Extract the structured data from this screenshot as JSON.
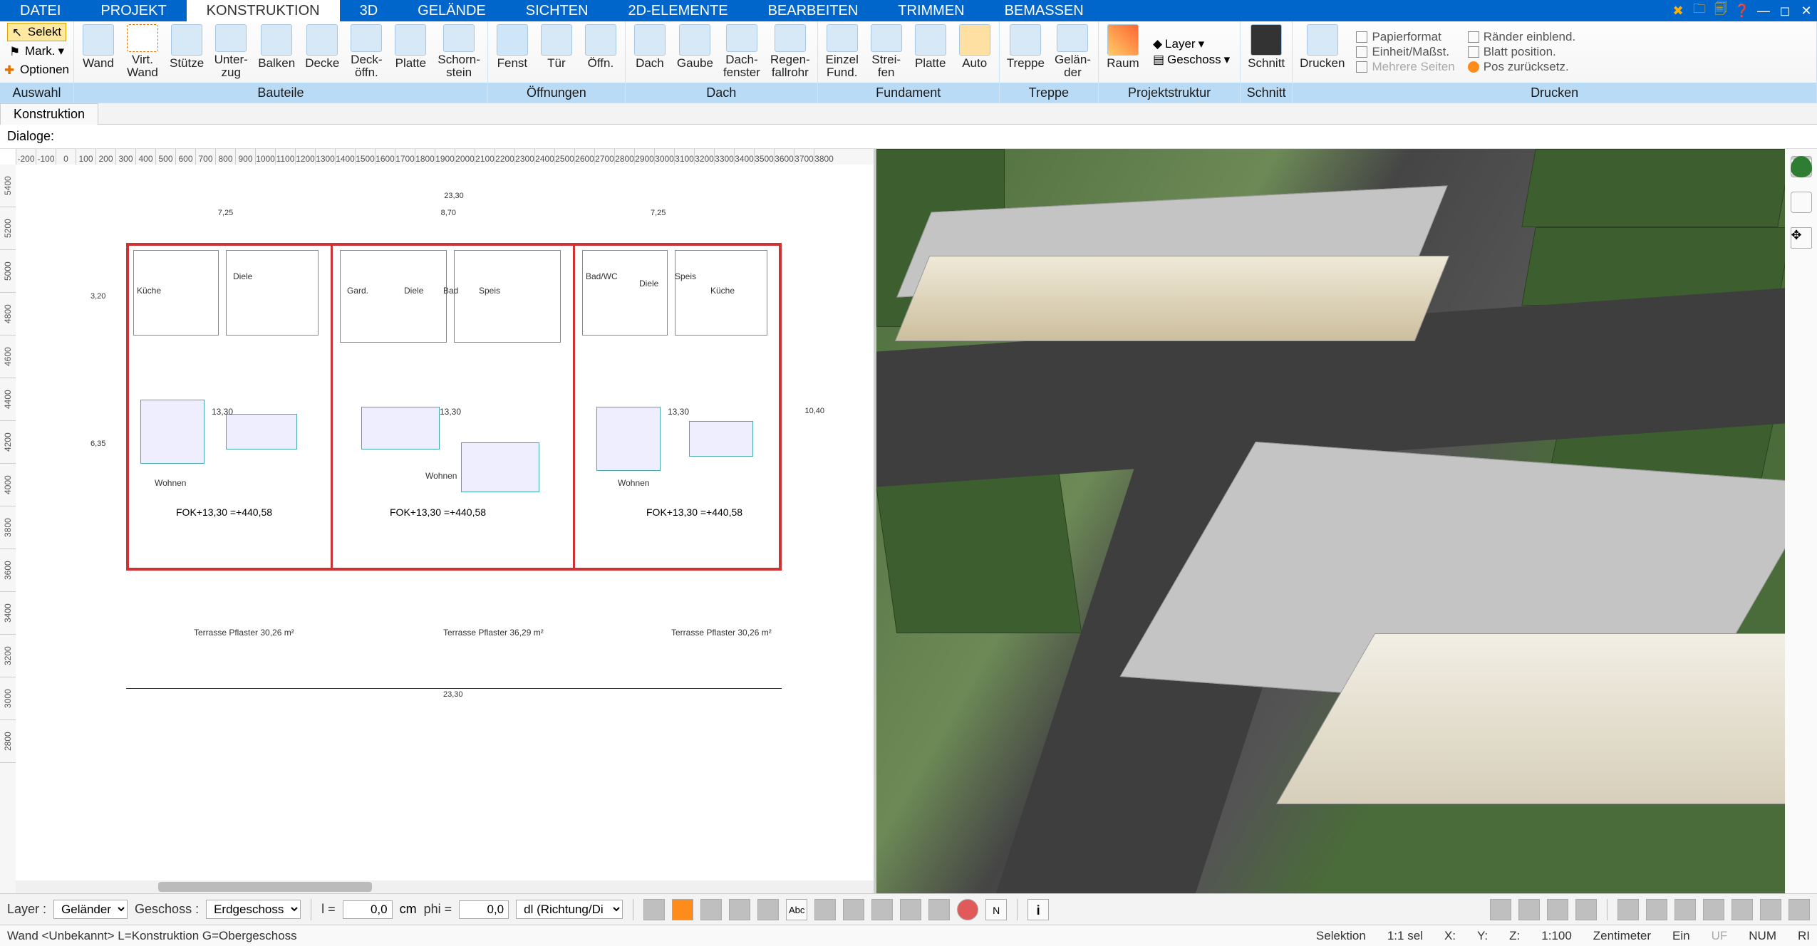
{
  "menu": {
    "tabs": [
      "DATEI",
      "PROJEKT",
      "KONSTRUKTION",
      "3D",
      "GELÄNDE",
      "SICHTEN",
      "2D-ELEMENTE",
      "BEARBEITEN",
      "TRIMMEN",
      "BEMASSEN"
    ],
    "active_index": 2
  },
  "ribbon": {
    "groups": [
      {
        "label": "Auswahl"
      },
      {
        "label": "Bauteile"
      },
      {
        "label": "Öffnungen"
      },
      {
        "label": "Dach"
      },
      {
        "label": "Fundament"
      },
      {
        "label": "Treppe"
      },
      {
        "label": "Projektstruktur"
      },
      {
        "label": "Schnitt"
      },
      {
        "label": "Drucken"
      }
    ],
    "selection": {
      "selekt": "Selekt",
      "mark": "Mark.",
      "optionen": "Optionen"
    },
    "bauteile": [
      "Wand",
      "Virt.\nWand",
      "Stütze",
      "Unter-\nzug",
      "Balken",
      "Decke",
      "Deck-\nöffn.",
      "Platte",
      "Schorn-\nstein"
    ],
    "oeffnungen": [
      "Fenst",
      "Tür",
      "Öffn."
    ],
    "dach": [
      "Dach",
      "Gaube",
      "Dach-\nfenster",
      "Regen-\nfallrohr"
    ],
    "fundament": [
      "Einzel\nFund.",
      "Strei-\nfen",
      "Platte",
      "Auto"
    ],
    "treppe": [
      "Treppe",
      "Gelän-\nder"
    ],
    "projekt": {
      "raum": "Raum",
      "layer": "Layer",
      "geschoss": "Geschoss"
    },
    "schnitt": "Schnitt",
    "drucken": {
      "drucken": "Drucken",
      "links": [
        "Papierformat",
        "Einheit/Maßst.",
        "Mehrere Seiten",
        "Ränder einblend.",
        "Blatt position.",
        "Pos zurücksetz."
      ]
    }
  },
  "secbar": {
    "tab": "Konstruktion",
    "dialoge": "Dialoge:"
  },
  "floorplan": {
    "overall_width": "23,30",
    "col1_width": "7,25",
    "col2_width": "8,70",
    "col3_width": "7,25",
    "height": "10,40",
    "upper": "3,20",
    "lower": "6,35",
    "units": [
      {
        "fok": "FOK+13,30\n=+440,58",
        "rooms": [
          "Speis",
          "Diele",
          "Küche",
          "Wohnen"
        ]
      },
      {
        "fok": "FOK+13,30\n=+440,58",
        "rooms": [
          "Gard.",
          "Diele",
          "Bad",
          "Speis",
          "Wohnen"
        ]
      },
      {
        "fok": "FOK+13,30\n=+440,58",
        "rooms": [
          "Bad/WC",
          "Diele",
          "Speis",
          "Küche",
          "Wohnen"
        ]
      }
    ],
    "terraces": [
      "Terrasse\nPflaster\n30,26 m²",
      "Terrasse\nPflaster\n36,29 m²",
      "Terrasse\nPflaster\n30,26 m²"
    ],
    "level": "13,30"
  },
  "bottom": {
    "layer_label": "Layer :",
    "layer_value": "Geländer",
    "geschoss_label": "Geschoss :",
    "geschoss_value": "Erdgeschoss",
    "l_label": "l =",
    "l_value": "0,0",
    "l_unit": "cm",
    "phi_label": "phi =",
    "phi_value": "0,0",
    "mode": "dl (Richtung/Di"
  },
  "status": {
    "left": "Wand <Unbekannt> L=Konstruktion G=Obergeschoss",
    "sel": "Selektion",
    "scale": "1:1 sel",
    "x": "X:",
    "y": "Y:",
    "z": "Z:",
    "scale2": "1:100",
    "unit": "Zentimeter",
    "ein": "Ein",
    "uf": "UF",
    "num": "NUM",
    "ri": "RI"
  }
}
